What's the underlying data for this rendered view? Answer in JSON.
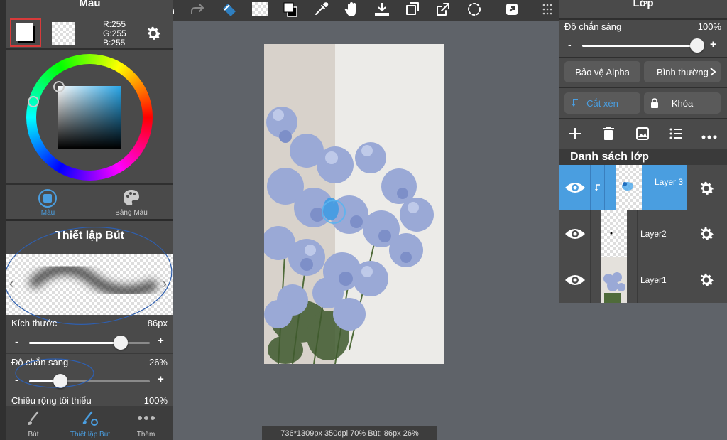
{
  "colors": {
    "accent": "#4a9ee0",
    "panel": "#4a4a4a",
    "canvas_bg": "#5f6369"
  },
  "left_panel": {
    "title": "Màu",
    "rgb": {
      "r": "R:255",
      "g": "G:255",
      "b": "B:255"
    },
    "tabs": [
      {
        "label": "Màu"
      },
      {
        "label": "Bảng Màu"
      }
    ],
    "brush_section_title": "Thiết lập Bút",
    "size": {
      "label": "Kích thước",
      "value": "86px",
      "level": 0.76
    },
    "opacity": {
      "label": "Độ chắn sáng",
      "value": "26%",
      "level": 0.26
    },
    "min_width": {
      "label": "Chiều rộng tối thiểu",
      "value": "100%"
    },
    "bottom_tabs": [
      {
        "label": "Bút"
      },
      {
        "label": "Thiết lập Bút"
      },
      {
        "label": "Thêm"
      }
    ]
  },
  "status_bar": "736*1309px 350dpi 70% Bút: 86px 26%",
  "right_panel": {
    "title": "Lớp",
    "opacity": {
      "label": "Độ chắn sáng",
      "value": "100%",
      "level": 1.0
    },
    "alpha_protect": "Bảo vệ Alpha",
    "blend_mode": "Bình thường",
    "clip_label": "Cắt xén",
    "lock_label": "Khóa",
    "layer_list_title": "Danh sách lớp",
    "layers": [
      {
        "name": "Layer 3"
      },
      {
        "name": "Layer2"
      },
      {
        "name": "Layer1"
      }
    ]
  },
  "icons": [
    "undo-icon",
    "redo-icon",
    "transform-icon",
    "fill-icon",
    "swap-colors-icon",
    "eyedropper-icon",
    "hand-icon",
    "save-icon",
    "resize-icon",
    "export-icon",
    "lasso-icon",
    "share-icon",
    "menu-grid-icon",
    "gear-icon",
    "palette-icon",
    "eye-icon",
    "add-icon",
    "trash-icon",
    "image-icon",
    "list-icon",
    "more-icon",
    "lock-icon",
    "clip-icon"
  ]
}
